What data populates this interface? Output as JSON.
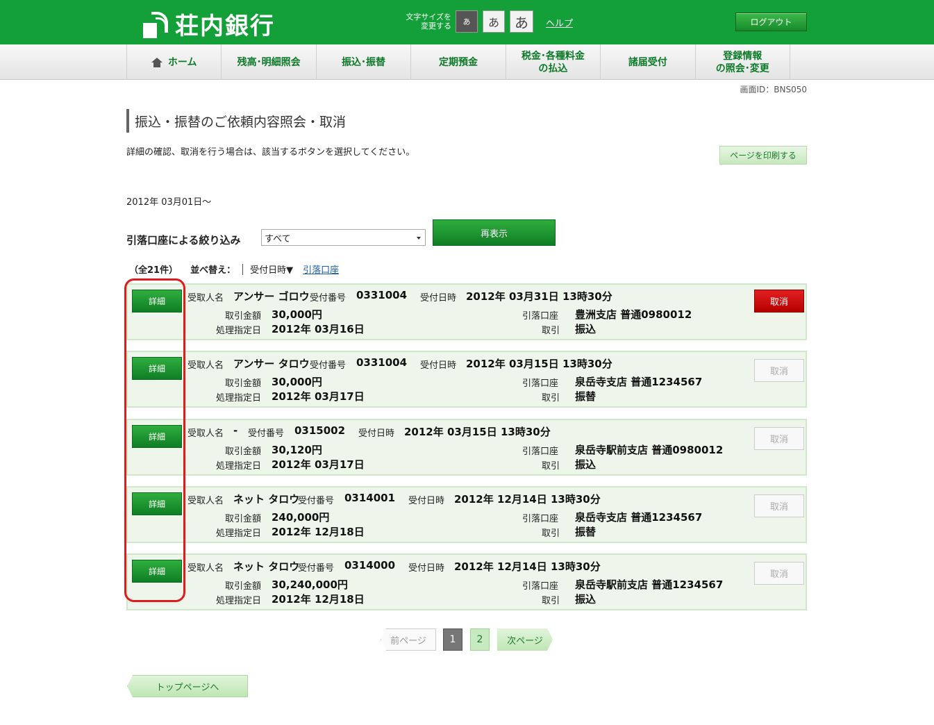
{
  "header": {
    "bank_name": "荘内銀行",
    "font_size_label_line1": "文字サイズを",
    "font_size_label_line2": "変更する",
    "font_small": "あ",
    "font_medium": "あ",
    "font_large": "あ",
    "help": "ヘルプ",
    "logout": "ログアウト"
  },
  "nav": {
    "items": [
      {
        "label": "ホーム"
      },
      {
        "label": "残高･明細照会"
      },
      {
        "label": "振込･振替"
      },
      {
        "label": "定期預金"
      },
      {
        "label_line1": "税金･各種料金",
        "label_line2": "の払込"
      },
      {
        "label": "諸届受付"
      },
      {
        "label_line1": "登録情報",
        "label_line2": "の照会･変更"
      }
    ]
  },
  "screen_id": "画面ID：BNS050",
  "page": {
    "title": "振込・振替のご依頼内容照会・取消",
    "instruction": "詳細の確認、取消を行う場合は、該当するボタンを選択してください。",
    "print_button": "ページを印刷する",
    "date_range": "2012年 03月01日～",
    "filter_label": "引落口座による絞り込み",
    "filter_value": "すべて",
    "redisplay_button": "再表示",
    "total_count": "（全21件）",
    "sort_label": "並べ替え：",
    "sort_current": "受付日時▼",
    "sort_alt": "引落口座"
  },
  "labels": {
    "recipient": "受取人名",
    "receipt_no": "受付番号",
    "receipt_datetime": "受付日時",
    "amount": "取引金額",
    "process_date": "処理指定日",
    "debit_account": "引落口座",
    "transaction": "取引",
    "detail_button": "詳細",
    "cancel_button": "取消"
  },
  "rows": [
    {
      "recipient": "アンサー ゴロウ",
      "receipt_no": "0331004",
      "receipt_datetime": "2012年 03月31日 13時30分",
      "amount": "30,000円",
      "process_date": "2012年 03月16日",
      "debit_account": "豊洲支店  普通0980012",
      "transaction": "振込",
      "cancel_enabled": true
    },
    {
      "recipient": "アンサー タロウ",
      "receipt_no": "0331004",
      "receipt_datetime": "2012年 03月15日 13時30分",
      "amount": "30,000円",
      "process_date": "2012年 03月17日",
      "debit_account": "泉岳寺支店  普通1234567",
      "transaction": "振替",
      "cancel_enabled": false
    },
    {
      "recipient": "-",
      "receipt_no": "0315002",
      "receipt_datetime": "2012年 03月15日 13時30分",
      "amount": "30,120円",
      "process_date": "2012年 03月17日",
      "debit_account": "泉岳寺駅前支店  普通0980012",
      "transaction": "振込",
      "cancel_enabled": false
    },
    {
      "recipient": "ネット タロウ",
      "receipt_no": "0314001",
      "receipt_datetime": "2012年 12月14日 13時30分",
      "amount": "240,000円",
      "process_date": "2012年 12月18日",
      "debit_account": "泉岳寺支店  普通1234567",
      "transaction": "振替",
      "cancel_enabled": false
    },
    {
      "recipient": "ネット タロウ",
      "receipt_no": "0314000",
      "receipt_datetime": "2012年 12月14日 13時30分",
      "amount": "30,240,000円",
      "process_date": "2012年 12月18日",
      "debit_account": "泉岳寺駅前支店  普通1234567",
      "transaction": "振込",
      "cancel_enabled": false
    }
  ],
  "pagination": {
    "prev": "前ページ",
    "page1": "1",
    "page2": "2",
    "next": "次ページ"
  },
  "top_page_button": "トップページへ",
  "colors": {
    "brand_green": "#13a039",
    "cancel_red": "#d40d0d",
    "highlight_red": "#e01b1b"
  }
}
